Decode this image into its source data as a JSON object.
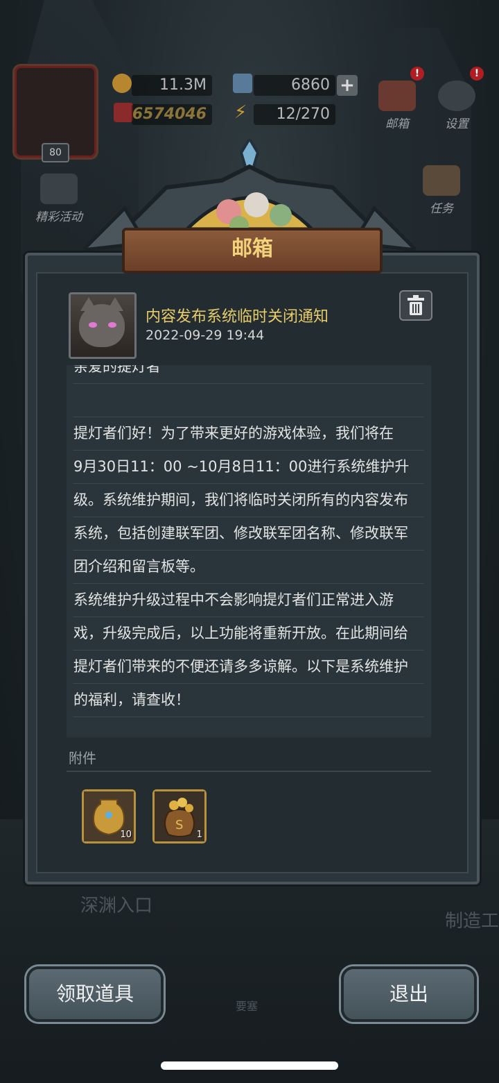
{
  "hud": {
    "level": "80",
    "gold": "11.3M",
    "crystal": "6860",
    "power": "6574046",
    "energy": "12/270",
    "mailbox_label": "邮箱",
    "settings_label": "设置",
    "event_label": "精彩活动",
    "task_label": "任务"
  },
  "background": {
    "abyss_entrance": "深渊入口",
    "workshop": "制造工",
    "fortress": "要塞"
  },
  "dialog": {
    "title": "邮箱",
    "mail_title": "内容发布系统临时关闭通知",
    "mail_date": "2022-09-29 19:44",
    "cut_line": "亲爱的提灯者",
    "body_lines": [
      "",
      "提灯者们好！为了带来更好的游戏体验，我们将在",
      "9月30日11：00 ~10月8日11：00进行系统维护升",
      "级。系统维护期间，我们将临时关闭所有的内容发布",
      "系统，包括创建联军团、修改联军团名称、修改联军",
      "团介绍和留言板等。",
      "系统维护升级过程中不会影响提灯者们正常进入游",
      "戏，升级完成后，以上功能将重新开放。在此期间给",
      "提灯者们带来的不便还请多多谅解。以下是系统维护",
      "的福利，请查收！"
    ],
    "attachments_label": "附件",
    "attachments": [
      {
        "icon": "golden-urn-icon",
        "qty": "10"
      },
      {
        "icon": "coin-bag-icon",
        "qty": "1"
      }
    ]
  },
  "buttons": {
    "claim": "领取道具",
    "exit": "退出"
  },
  "colors": {
    "title_gold": "#e8cc6a",
    "banner_text": "#f2d27a",
    "panel": "#2b363c"
  }
}
